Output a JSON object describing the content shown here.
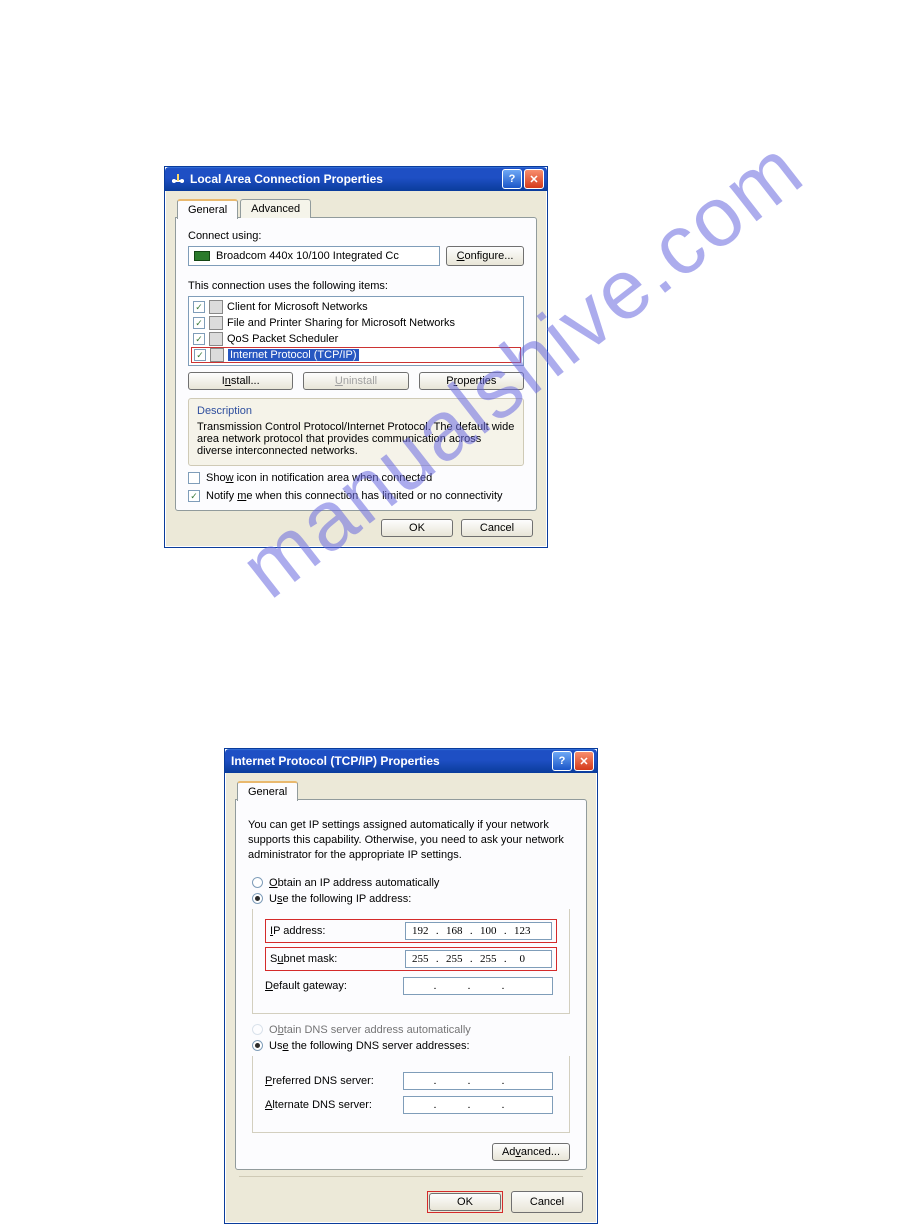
{
  "watermark": "manualshive.com",
  "win1": {
    "title": "Local Area Connection Properties",
    "tabs": {
      "general": "General",
      "advanced": "Advanced"
    },
    "connect_using_label": "Connect using:",
    "adapter": "Broadcom 440x 10/100 Integrated Cc",
    "configure_btn": "Configure...",
    "items_label": "This connection uses the following items:",
    "items": [
      {
        "label": "Client for Microsoft Networks",
        "checked": true
      },
      {
        "label": "File and Printer Sharing for Microsoft Networks",
        "checked": true
      },
      {
        "label": "QoS Packet Scheduler",
        "checked": true
      },
      {
        "label": "Internet Protocol (TCP/IP)",
        "checked": true,
        "selected": true
      }
    ],
    "install_btn": "Install...",
    "uninstall_btn": "Uninstall",
    "properties_btn": "Properties",
    "desc_title": "Description",
    "desc_text": "Transmission Control Protocol/Internet Protocol. The default wide area network protocol that provides communication across diverse interconnected networks.",
    "show_icon": "Show icon in notification area when connected",
    "show_icon_checked": false,
    "notify_limited": "Notify me when this connection has limited or no connectivity",
    "notify_limited_checked": true,
    "ok": "OK",
    "cancel": "Cancel"
  },
  "win2": {
    "title": "Internet Protocol (TCP/IP) Properties",
    "tabs": {
      "general": "General"
    },
    "intro": "You can get IP settings assigned automatically if your network supports this capability. Otherwise, you need to ask your network administrator for the appropriate IP settings.",
    "radio_auto_ip": "Obtain an IP address automatically",
    "radio_manual_ip": "Use the following IP address:",
    "ip_label": "IP address:",
    "ip_value": [
      "192",
      "168",
      "100",
      "123"
    ],
    "mask_label": "Subnet mask:",
    "mask_value": [
      "255",
      "255",
      "255",
      "0"
    ],
    "gw_label": "Default gateway:",
    "gw_value": [
      "",
      "",
      "",
      ""
    ],
    "radio_auto_dns": "Obtain DNS server address automatically",
    "radio_manual_dns": "Use the following DNS server addresses:",
    "pref_dns_label": "Preferred DNS server:",
    "alt_dns_label": "Alternate DNS server:",
    "advanced_btn": "Advanced...",
    "ok": "OK",
    "cancel": "Cancel"
  }
}
